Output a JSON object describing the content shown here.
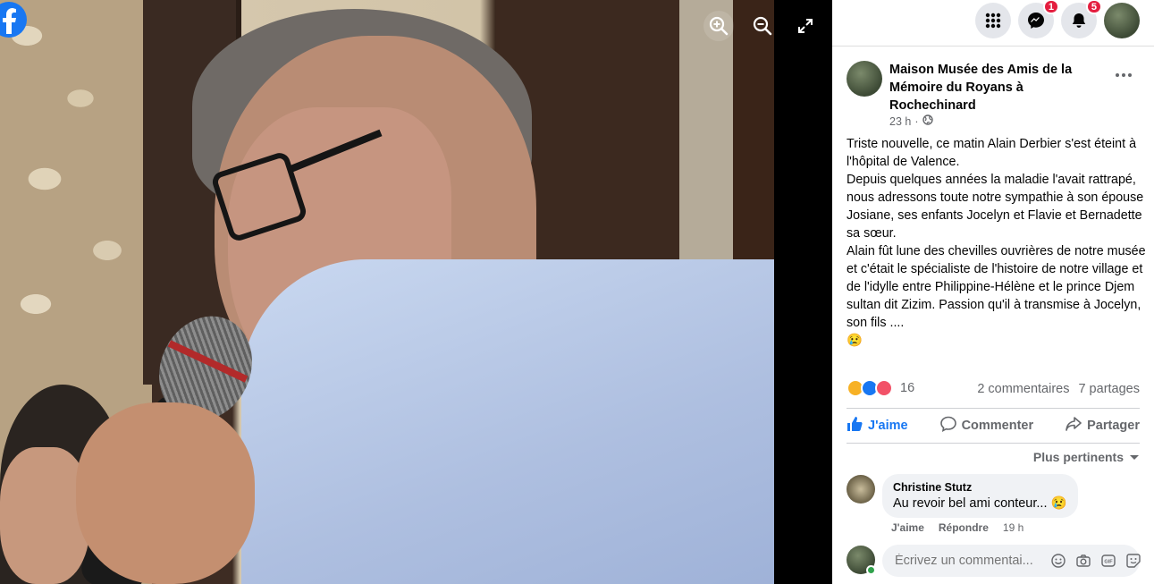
{
  "viewer": {
    "zoom_in_icon": "zoom-in-icon",
    "zoom_out_icon": "zoom-out-icon",
    "fullscreen_icon": "fullscreen-icon"
  },
  "topbar": {
    "messenger_badge": "1",
    "notifications_badge": "5"
  },
  "post": {
    "page_name": "Maison Musée des Amis de la Mémoire du Royans à Rochechinard",
    "time": "23 h",
    "text_lines": [
      "Triste nouvelle, ce matin Alain Derbier s'est éteint à l'hôpital de Valence.",
      "Depuis quelques années la maladie l'avait rattrapé, nous adressons toute notre sympathie à son épouse Josiane, ses enfants Jocelyn et Flavie et Bernadette sa sœur.",
      "Alain fût lune des chevilles ouvrières de notre musée et c'était le spécialiste de l'histoire de notre village et de l'idylle entre Philippine-Hélène et le prince Djem sultan dit Zizim. Passion qu'il à transmise à Jocelyn, son fils ....",
      "😢"
    ],
    "reaction_count": "16",
    "comments_count": "2 commentaires",
    "shares_count": "7 partages"
  },
  "actions": {
    "like": "J'aime",
    "comment": "Commenter",
    "share": "Partager"
  },
  "comments": {
    "sort_label": "Plus pertinents",
    "items": [
      {
        "author": "Christine Stutz",
        "text": "Au revoir bel ami conteur...",
        "emoji": "😢",
        "like": "J'aime",
        "reply": "Répondre",
        "time": "19 h"
      }
    ],
    "write_placeholder": "Écrivez un commentai..."
  },
  "colors": {
    "facebook_blue": "#1877f2",
    "badge_red": "#e41e3f"
  }
}
